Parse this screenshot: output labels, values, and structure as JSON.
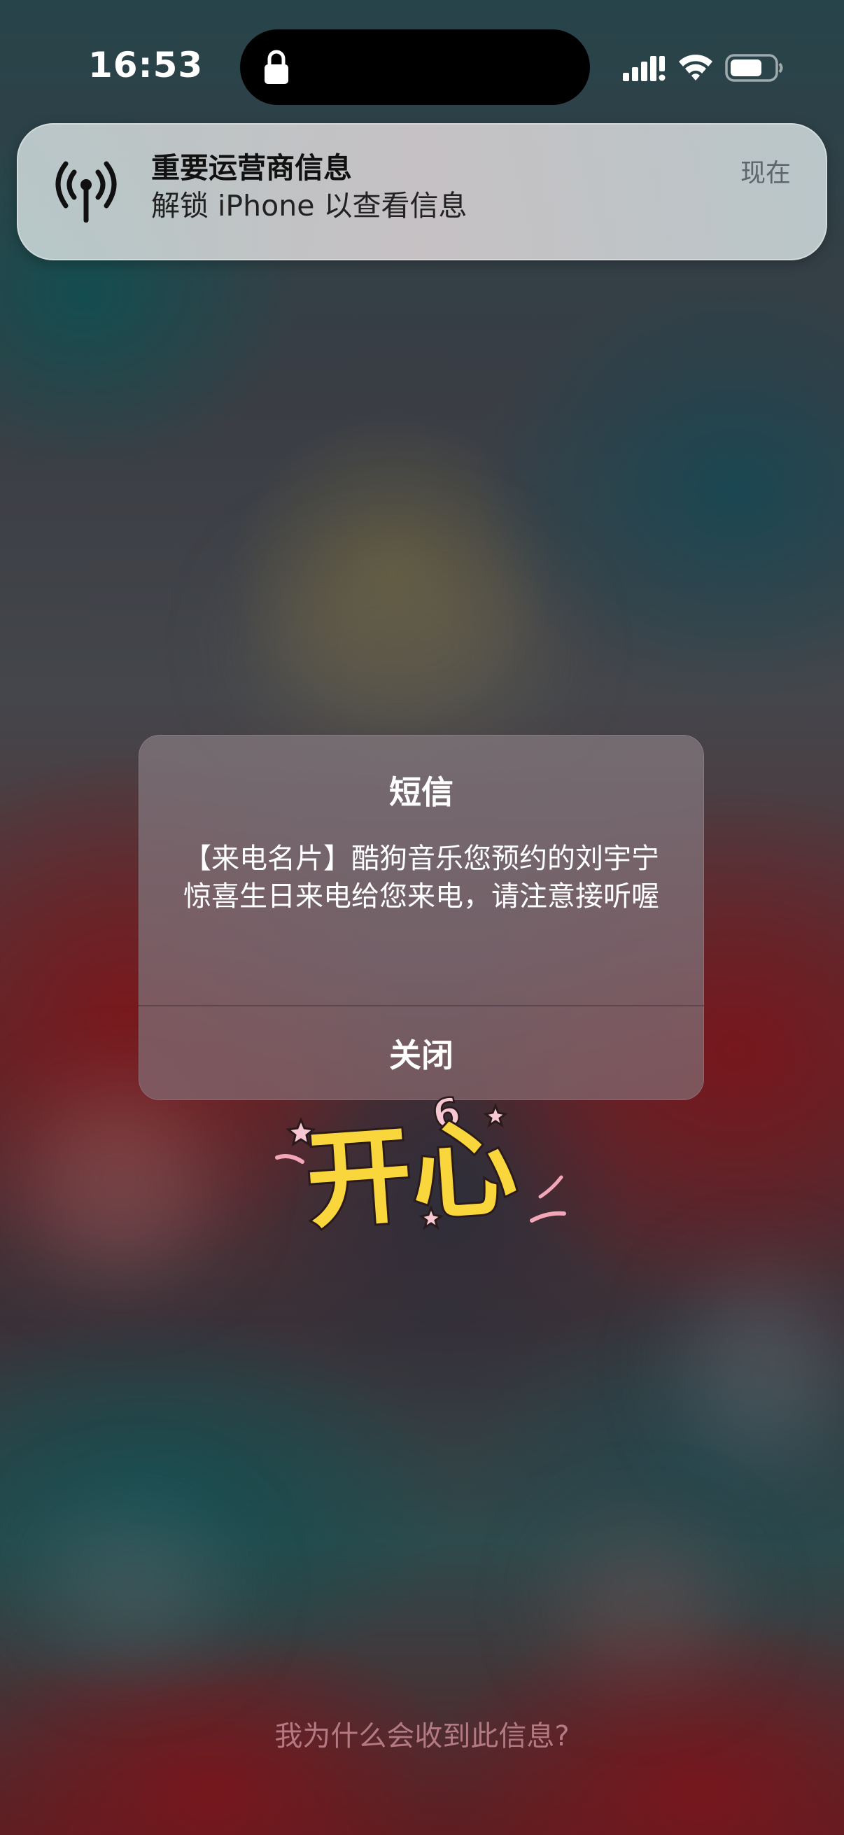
{
  "status_bar": {
    "time": "16:53",
    "icons": [
      "lock-icon",
      "cellular-signal-icon",
      "wifi-icon",
      "battery-icon"
    ]
  },
  "notification": {
    "icon": "antenna-broadcast-icon",
    "title": "重要运营商信息",
    "body": "解锁 iPhone 以查看信息",
    "time": "现在"
  },
  "alert": {
    "title": "短信",
    "message": "【来电名片】酷狗音乐您预约的刘宇宁惊喜生日来电给您来电，请注意接听喔",
    "close_label": "关闭"
  },
  "sticker": {
    "text": "开心",
    "superscript": "6"
  },
  "footer": {
    "link_label": "我为什么会收到此信息?"
  },
  "colors": {
    "banner_bg": "#d8dcdc",
    "alert_bg": "#7e6e76",
    "footer_link": "#b47a84",
    "sticker_yellow": "#f9d63c"
  }
}
